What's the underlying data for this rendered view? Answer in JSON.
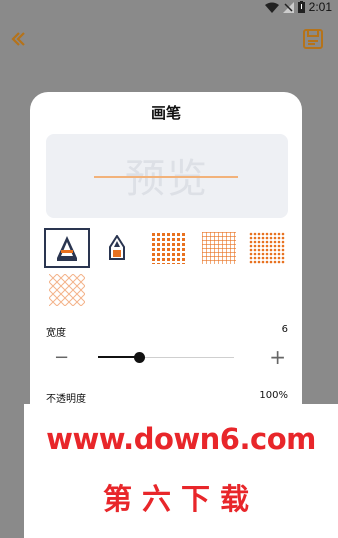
{
  "status": {
    "time": "2:01"
  },
  "dialog": {
    "title": "画笔",
    "preview_text": "预览",
    "width_label": "宽度",
    "width_value": "6",
    "opacity_label": "不透明度",
    "opacity_value": "100%",
    "slider": {
      "minus": "−",
      "plus": "+",
      "level": 0.3
    }
  },
  "brushes": [
    {
      "name": "cone-brush",
      "selected": true
    },
    {
      "name": "pencil-brush",
      "selected": false
    },
    {
      "name": "dots-brush",
      "selected": false
    },
    {
      "name": "grid-brush",
      "selected": false
    },
    {
      "name": "dense-dots-brush",
      "selected": false
    },
    {
      "name": "crosshatch-brush",
      "selected": false
    }
  ],
  "colors": {
    "accent": "#e8711f",
    "brush_dark": "#2a3550",
    "banner_red": "#e8262a"
  },
  "banner": {
    "url": "www.down6.com",
    "subtitle": "第六下载"
  }
}
